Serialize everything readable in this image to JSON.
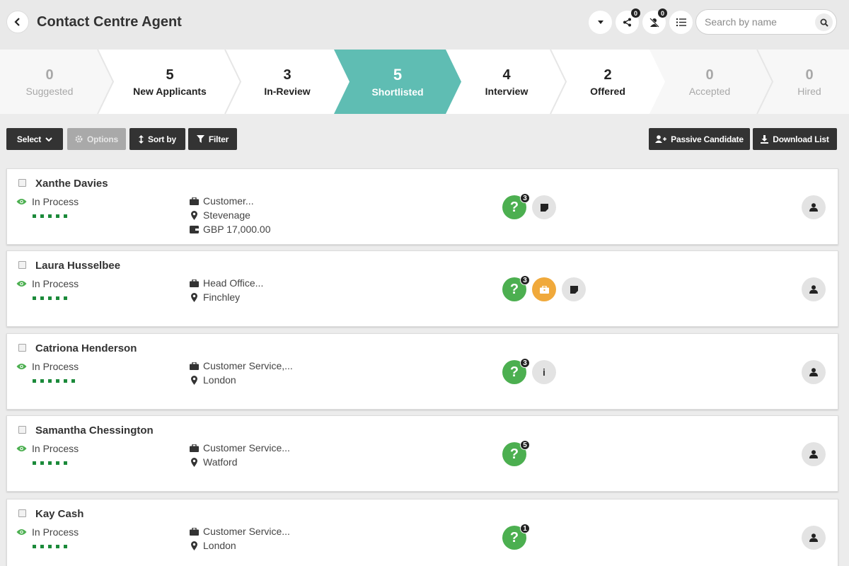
{
  "header": {
    "title": "Contact Centre Agent",
    "share_badge": "0",
    "reject_badge": "0",
    "search_placeholder": "Search by name"
  },
  "pipeline": {
    "stages": [
      {
        "count": "0",
        "label": "Suggested"
      },
      {
        "count": "5",
        "label": "New Applicants"
      },
      {
        "count": "3",
        "label": "In-Review"
      },
      {
        "count": "5",
        "label": "Shortlisted"
      },
      {
        "count": "4",
        "label": "Interview"
      },
      {
        "count": "2",
        "label": "Offered"
      },
      {
        "count": "0",
        "label": "Accepted"
      },
      {
        "count": "0",
        "label": "Hired"
      }
    ],
    "active_color": "#5fbdb3"
  },
  "toolbar": {
    "select": "Select",
    "options": "Options",
    "sort": "Sort by",
    "filter": "Filter",
    "passive": "Passive Candidate",
    "download": "Download List"
  },
  "candidates": [
    {
      "name": "Xanthe Davies",
      "status": "In Process",
      "job": "Customer...",
      "location": "Stevenage",
      "salary": "GBP 17,000.00",
      "questions_badge": "3"
    },
    {
      "name": "Laura Husselbee",
      "status": "In Process",
      "job": "Head Office...",
      "location": "Finchley",
      "questions_badge": "3"
    },
    {
      "name": "Catriona Henderson",
      "status": "In Process",
      "job": "Customer Service,...",
      "location": "London",
      "questions_badge": "3",
      "info_label": "i"
    },
    {
      "name": "Samantha Chessington",
      "status": "In Process",
      "job": "Customer Service...",
      "location": "Watford",
      "questions_badge": "5"
    },
    {
      "name": "Kay Cash",
      "status": "In Process",
      "job": "Customer Service...",
      "location": "London",
      "questions_badge": "1"
    }
  ],
  "colors": {
    "accent_teal": "#5fbdb3",
    "status_green": "#4caf50",
    "warning_orange": "#f0a93b",
    "toolbar_dark": "#333333"
  }
}
